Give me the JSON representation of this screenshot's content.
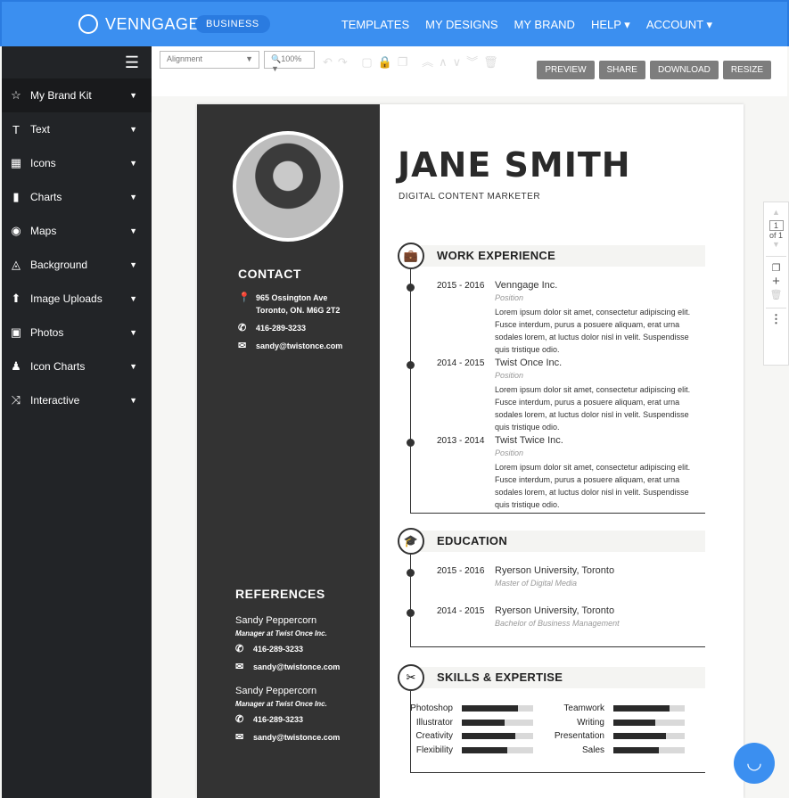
{
  "header": {
    "logo": "VENNGAGE",
    "plan_badge": "BUSINESS",
    "nav": [
      "TEMPLATES",
      "MY DESIGNS",
      "MY BRAND",
      "HELP ▾",
      "ACCOUNT ▾"
    ]
  },
  "sidebar": {
    "items": [
      {
        "label": "My Brand Kit",
        "icon": "☆"
      },
      {
        "label": "Text",
        "icon": "T"
      },
      {
        "label": "Icons",
        "icon": "▦"
      },
      {
        "label": "Charts",
        "icon": "▮"
      },
      {
        "label": "Maps",
        "icon": "◉"
      },
      {
        "label": "Background",
        "icon": "◬"
      },
      {
        "label": "Image Uploads",
        "icon": "⬆"
      },
      {
        "label": "Photos",
        "icon": "▣"
      },
      {
        "label": "Icon Charts",
        "icon": "♟"
      },
      {
        "label": "Interactive",
        "icon": "⤨"
      }
    ]
  },
  "toolbar": {
    "alignment": "Alignment",
    "zoom": "100%",
    "buttons": [
      "PREVIEW",
      "SHARE",
      "DOWNLOAD",
      "RESIZE"
    ]
  },
  "resume": {
    "name": "JANE SMITH",
    "role": "DIGITAL CONTENT MARKETER",
    "contact": {
      "title": "CONTACT",
      "address1": "965 Ossington Ave",
      "address2": "Toronto, ON. M6G 2T2",
      "phone": "416-289-3233",
      "email": "sandy@twistonce.com"
    },
    "references": {
      "title": "REFERENCES",
      "items": [
        {
          "name": "Sandy Peppercorn",
          "title": "Manager at Twist Once Inc.",
          "phone": "416-289-3233",
          "email": "sandy@twistonce.com"
        },
        {
          "name": "Sandy Peppercorn",
          "title": "Manager at Twist Once Inc.",
          "phone": "416-289-3233",
          "email": "sandy@twistonce.com"
        }
      ]
    },
    "work": {
      "title": "WORK EXPERIENCE",
      "jobs": [
        {
          "years": "2015 - 2016",
          "company": "Venngage Inc.",
          "position": "Position",
          "desc": "Lorem ipsum dolor sit amet, consectetur adipiscing elit. Fusce interdum, purus a posuere aliquam, erat urna sodales lorem, at luctus dolor nisl in velit. Suspendisse quis tristique odio."
        },
        {
          "years": "2014 - 2015",
          "company": "Twist Once Inc.",
          "position": "Position",
          "desc": "Lorem ipsum dolor sit amet, consectetur adipiscing elit. Fusce interdum, purus a posuere aliquam, erat urna sodales lorem, at luctus dolor nisl in velit. Suspendisse quis tristique odio."
        },
        {
          "years": "2013 - 2014",
          "company": "Twist Twice Inc.",
          "position": "Position",
          "desc": "Lorem ipsum dolor sit amet, consectetur adipiscing elit. Fusce interdum, purus a posuere aliquam, erat urna sodales lorem, at luctus dolor nisl in velit. Suspendisse quis tristique odio."
        }
      ]
    },
    "education": {
      "title": "EDUCATION",
      "items": [
        {
          "years": "2015 - 2016",
          "school": "Ryerson University, Toronto",
          "degree": "Master of Digital Media"
        },
        {
          "years": "2014 - 2015",
          "school": "Ryerson University, Toronto",
          "degree": "Bachelor of Business Management"
        }
      ]
    },
    "skills": {
      "title": "SKILLS & EXPERTISE",
      "left": [
        {
          "name": "Photoshop",
          "level": 79
        },
        {
          "name": "Illustrator",
          "level": 60
        },
        {
          "name": "Creativity",
          "level": 75
        },
        {
          "name": "Flexibility",
          "level": 64
        }
      ],
      "right": [
        {
          "name": "Teamwork",
          "level": 79
        },
        {
          "name": "Writing",
          "level": 59
        },
        {
          "name": "Presentation",
          "level": 74
        },
        {
          "name": "Sales",
          "level": 64
        }
      ]
    }
  },
  "pager": {
    "page": "1",
    "of": "of 1"
  }
}
